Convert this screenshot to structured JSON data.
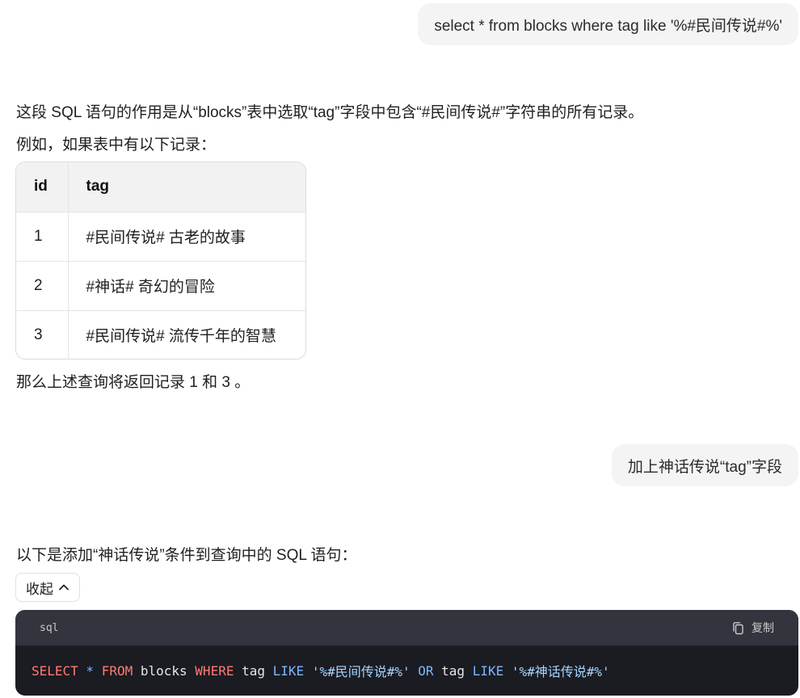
{
  "messages": {
    "user_1": "select * from blocks where tag like '%#民间传说#%'",
    "assistant_1": {
      "intro": "这段 SQL 语句的作用是从“blocks”表中选取“tag”字段中包含“#民间传说#”字符串的所有记录。",
      "example_lead": "例如，如果表中有以下记录：",
      "table": {
        "headers": [
          "id",
          "tag"
        ],
        "rows": [
          [
            "1",
            "#民间传说# 古老的故事"
          ],
          [
            "2",
            "#神话# 奇幻的冒险"
          ],
          [
            "3",
            "#民间传说# 流传千年的智慧"
          ]
        ]
      },
      "conclusion": "那么上述查询将返回记录 1 和 3 。"
    },
    "user_2": "加上神话传说“tag”字段",
    "assistant_2": {
      "intro": "以下是添加“神话传说”条件到查询中的 SQL 语句：",
      "collapse_label": "收起",
      "code": {
        "language": "sql",
        "copy_label": "复制",
        "tokens": {
          "t1": "SELECT",
          "t2": " * ",
          "t3": "FROM",
          "t4": " blocks ",
          "t5": "WHERE",
          "t6": " tag ",
          "t7": "LIKE",
          "t8": " ",
          "t9": "'%#民间传说#%'",
          "t10": " ",
          "t11": "OR",
          "t12": " tag ",
          "t13": "LIKE",
          "t14": " ",
          "t15": "'%#神话传说#%'"
        }
      }
    }
  },
  "icons": {
    "collapse": "chevron-up-icon",
    "copy": "copy-icon"
  },
  "colors": {
    "keyword": "#ff7b72",
    "operator": "#79b8ff",
    "string": "#a5d6ff",
    "code_bg": "#1b1b22",
    "code_header_bg": "#34343f"
  }
}
